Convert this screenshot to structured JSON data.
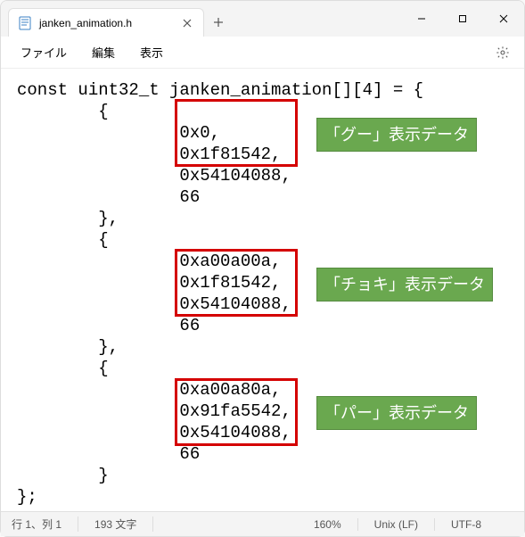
{
  "window": {
    "tab_title": "janken_animation.h"
  },
  "menubar": {
    "file": "ファイル",
    "edit": "編集",
    "view": "表示"
  },
  "code": {
    "l1": "const uint32_t janken_animation[][4] = {",
    "l2": "        {",
    "l3": "                0x0,",
    "l4": "                0x1f81542,",
    "l5": "                0x54104088,",
    "l6": "                66",
    "l7": "        },",
    "l8": "        {",
    "l9": "                0xa00a00a,",
    "l10": "                0x1f81542,",
    "l11": "                0x54104088,",
    "l12": "                66",
    "l13": "        },",
    "l14": "        {",
    "l15": "                0xa00a80a,",
    "l16": "                0x91fa5542,",
    "l17": "                0x54104088,",
    "l18": "                66",
    "l19": "        }",
    "l20": "};"
  },
  "annotations": {
    "gu": "「グー」表示データ",
    "choki": "「チョキ」表示データ",
    "pa": "「パー」表示データ"
  },
  "status": {
    "cursor": "行 1、列 1",
    "chars": "193 文字",
    "zoom": "160%",
    "eol": "Unix (LF)",
    "encoding": "UTF-8"
  }
}
